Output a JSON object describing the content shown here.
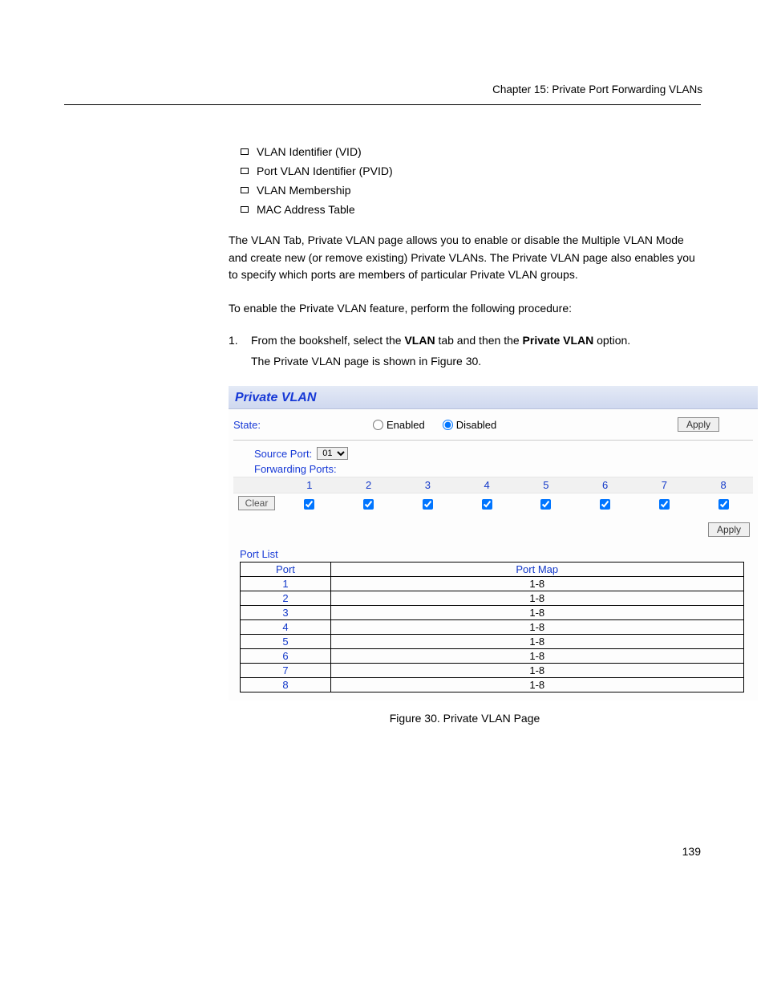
{
  "header": {
    "right": "Chapter 15: Private Port Forwarding VLANs"
  },
  "bullets": [
    "VLAN Identifier (VID)",
    "Port VLAN Identifier (PVID)",
    "VLAN Membership",
    "MAC Address Table"
  ],
  "body": {
    "p1": "The VLAN Tab, Private VLAN page allows you to enable or disable the Multiple VLAN Mode and create new (or remove existing) Private VLANs. The Private VLAN page also enables you to specify which ports are members of particular Private VLAN groups.",
    "p2": "To enable the Private VLAN feature, perform the following procedure:",
    "step1_num": "1.",
    "step1": "From the bookshelf, select the ",
    "step1_bold1": "VLAN",
    "step1_mid": " tab and then the ",
    "step1_bold2": "Private VLAN",
    "step1_end": " option.",
    "step1_after": "The Private VLAN page is shown in Figure 30."
  },
  "panel": {
    "title": "Private VLAN",
    "state_label": "State:",
    "enabled_label": "Enabled",
    "disabled_label": "Disabled",
    "apply_label": "Apply",
    "source_port_label": "Source Port:",
    "source_port_value": "01",
    "forwarding_ports_label": "Forwarding Ports:",
    "clear_label": "Clear",
    "port_headers": [
      "1",
      "2",
      "3",
      "4",
      "5",
      "6",
      "7",
      "8"
    ],
    "portlist_label": "Port List",
    "table": {
      "col1": "Port",
      "col2": "Port Map",
      "rows": [
        {
          "port": "1",
          "map": "1-8"
        },
        {
          "port": "2",
          "map": "1-8"
        },
        {
          "port": "3",
          "map": "1-8"
        },
        {
          "port": "4",
          "map": "1-8"
        },
        {
          "port": "5",
          "map": "1-8"
        },
        {
          "port": "6",
          "map": "1-8"
        },
        {
          "port": "7",
          "map": "1-8"
        },
        {
          "port": "8",
          "map": "1-8"
        }
      ]
    }
  },
  "figure_caption": "Figure 30. Private VLAN Page",
  "page_number": "139"
}
